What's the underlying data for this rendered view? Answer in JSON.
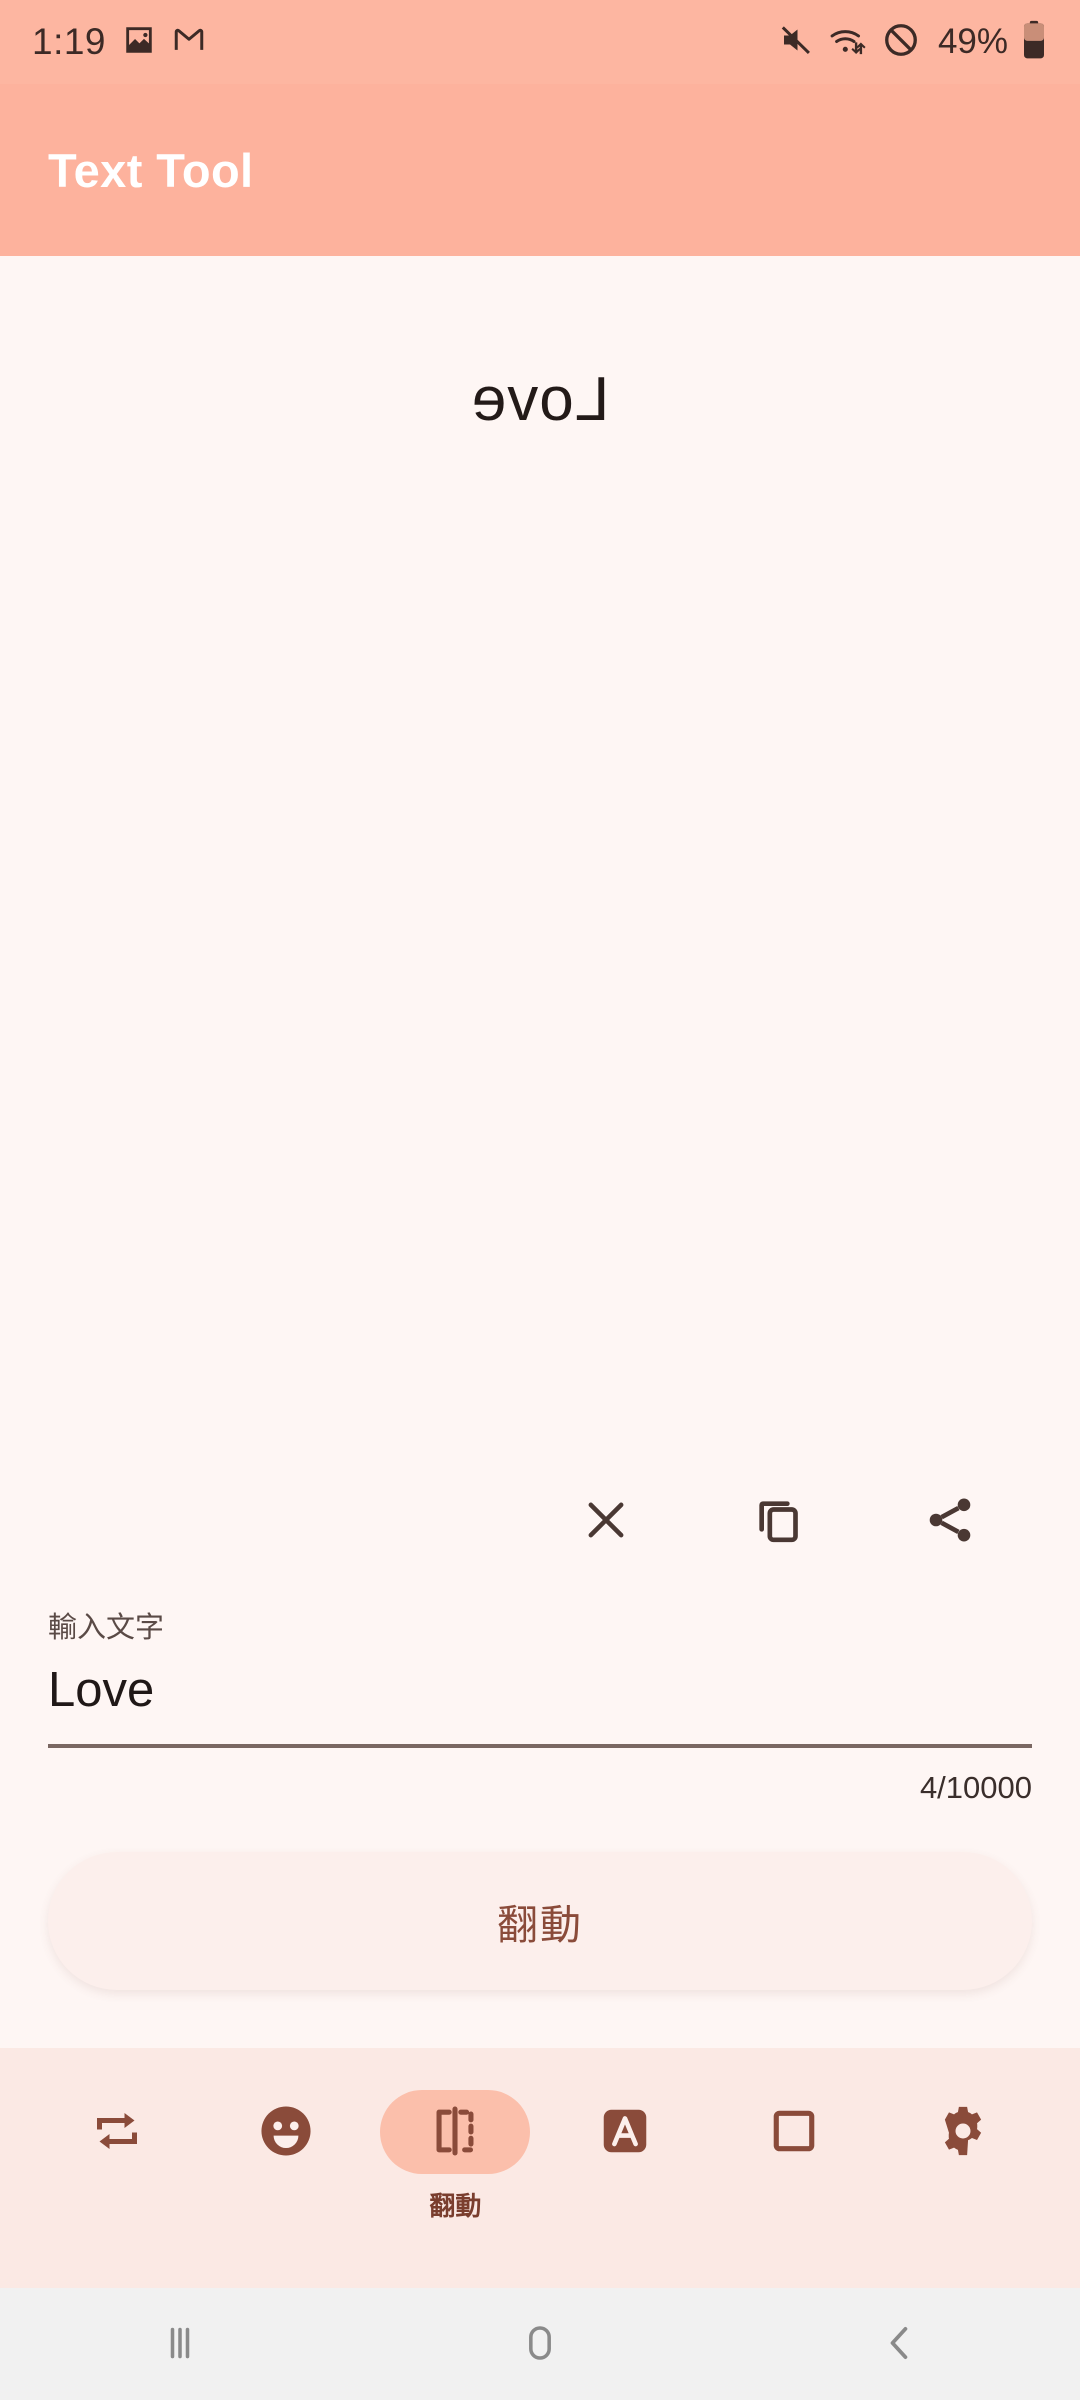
{
  "status_bar": {
    "time": "1:19",
    "left_icons": [
      "image-icon",
      "gmail-icon"
    ],
    "right_icons": [
      "mute-icon",
      "wifi-icon",
      "do-not-disturb-icon",
      "battery-icon"
    ],
    "battery_percent": "49%",
    "background_color": "#FDB6A1",
    "foreground_color": "#3C2A26"
  },
  "app_bar": {
    "title": "Text Tool",
    "background_color": "#FDB29D",
    "title_color": "#FFFFFF"
  },
  "preview": {
    "text": "Love",
    "transform": "mirror-horizontal",
    "text_color": "#231A18",
    "background_color": "#FEF6F4"
  },
  "actions": [
    {
      "name": "clear-button",
      "icon": "close-icon"
    },
    {
      "name": "copy-button",
      "icon": "copy-icon"
    },
    {
      "name": "share-button",
      "icon": "share-icon"
    }
  ],
  "input": {
    "label": "輸入文字",
    "value": "Love",
    "placeholder": "輸入文字",
    "counter": "4/10000",
    "underline_color": "#7A6762"
  },
  "primary_button": {
    "label": "翻動",
    "background_color": "#FCEFEC",
    "text_color": "#8A4B3A"
  },
  "toolbar": {
    "background_color": "#FBE9E4",
    "icon_color": "#8A4B3A",
    "active_pill_color": "#FBBFAB",
    "items": [
      {
        "name": "repeat-tool",
        "icon": "repeat-icon",
        "label": "",
        "active": false
      },
      {
        "name": "emoji-tool",
        "icon": "emoji-icon",
        "label": "",
        "active": false
      },
      {
        "name": "flip-tool",
        "icon": "flip-icon",
        "label": "翻動",
        "active": true
      },
      {
        "name": "font-tool",
        "icon": "font-a-icon",
        "label": "",
        "active": false
      },
      {
        "name": "background-tool",
        "icon": "square-icon",
        "label": "",
        "active": false
      },
      {
        "name": "settings-tool",
        "icon": "gear-icon",
        "label": "",
        "active": false
      }
    ]
  },
  "nav_bar": {
    "background_color": "#F1F1F1",
    "items": [
      {
        "name": "recents-button",
        "icon": "recents-icon"
      },
      {
        "name": "home-button",
        "icon": "home-icon"
      },
      {
        "name": "back-button",
        "icon": "back-icon"
      }
    ]
  }
}
